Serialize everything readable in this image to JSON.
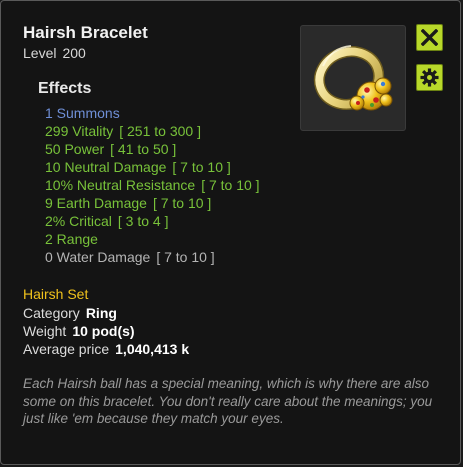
{
  "item": {
    "name": "Hairsh Bracelet",
    "level_label": "Level",
    "level_value": "200"
  },
  "effects": {
    "title": "Effects",
    "items": [
      {
        "text": "1 Summons",
        "range": "",
        "color": "#6f8fd6"
      },
      {
        "text": "299 Vitality",
        "range": "[ 251 to 300 ]",
        "color": "#78c23a"
      },
      {
        "text": "50 Power",
        "range": "[ 41 to 50 ]",
        "color": "#78c23a"
      },
      {
        "text": "10 Neutral Damage",
        "range": "[ 7 to 10 ]",
        "color": "#78c23a"
      },
      {
        "text": "10% Neutral Resistance",
        "range": "[ 7 to 10 ]",
        "color": "#78c23a"
      },
      {
        "text": "9 Earth Damage",
        "range": "[ 7 to 10 ]",
        "color": "#78c23a"
      },
      {
        "text": "2% Critical",
        "range": "[ 3 to 4 ]",
        "color": "#78c23a"
      },
      {
        "text": "2 Range",
        "range": "",
        "color": "#78c23a"
      },
      {
        "text": "0 Water Damage",
        "range": "[ 7 to 10 ]",
        "color": "#b4b4b4"
      }
    ]
  },
  "set": {
    "name": "Hairsh Set"
  },
  "properties": {
    "category_label": "Category",
    "category_value": "Ring",
    "weight_label": "Weight",
    "weight_value": "10 pod(s)",
    "price_label": "Average price",
    "price_value": "1,040,413 k"
  },
  "description": "Each Hairsh ball has a special meaning, which is why there are also some on this bracelet. You don't really care about the meanings; you just like 'em because they match your eyes.",
  "icons": {
    "close": "close-icon",
    "settings": "gear-icon",
    "item": "bracelet-icon"
  },
  "colors": {
    "accent": "#b8d82a",
    "set_name": "#f0c21c",
    "bonus_effect": "#78c23a",
    "summons_effect": "#6f8fd6",
    "inactive_effect": "#b4b4b4"
  }
}
